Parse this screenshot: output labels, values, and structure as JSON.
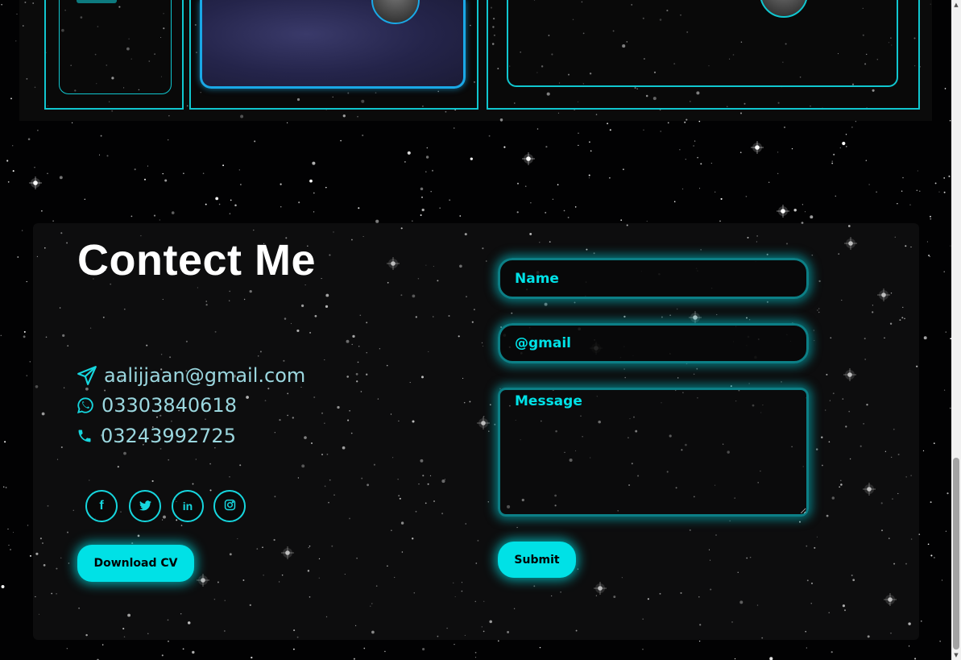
{
  "colors": {
    "accent": "#00e1e6",
    "accent_dark": "#0c7f86",
    "card_border": "#10c6cf",
    "title": "#ffffff",
    "info_text": "#9bd7df"
  },
  "contact": {
    "title": "Contect Me",
    "email": "aalijjaan@gmail.com",
    "whatsapp": "03303840618",
    "phone": "03243992725",
    "download_cv_label": "Download CV",
    "icons": {
      "email": "paper-plane-icon",
      "whatsapp": "whatsapp-icon",
      "phone": "phone-icon"
    },
    "socials": [
      {
        "name": "facebook",
        "icon": "facebook-icon",
        "glyph": "f"
      },
      {
        "name": "twitter",
        "icon": "twitter-icon",
        "glyph": ""
      },
      {
        "name": "linkedin",
        "icon": "linkedin-icon",
        "glyph": "in"
      },
      {
        "name": "instagram",
        "icon": "instagram-icon",
        "glyph": ""
      }
    ]
  },
  "form": {
    "name_placeholder": "Name",
    "email_placeholder": "@gmail",
    "message_placeholder": "Message",
    "submit_label": "Submit"
  }
}
